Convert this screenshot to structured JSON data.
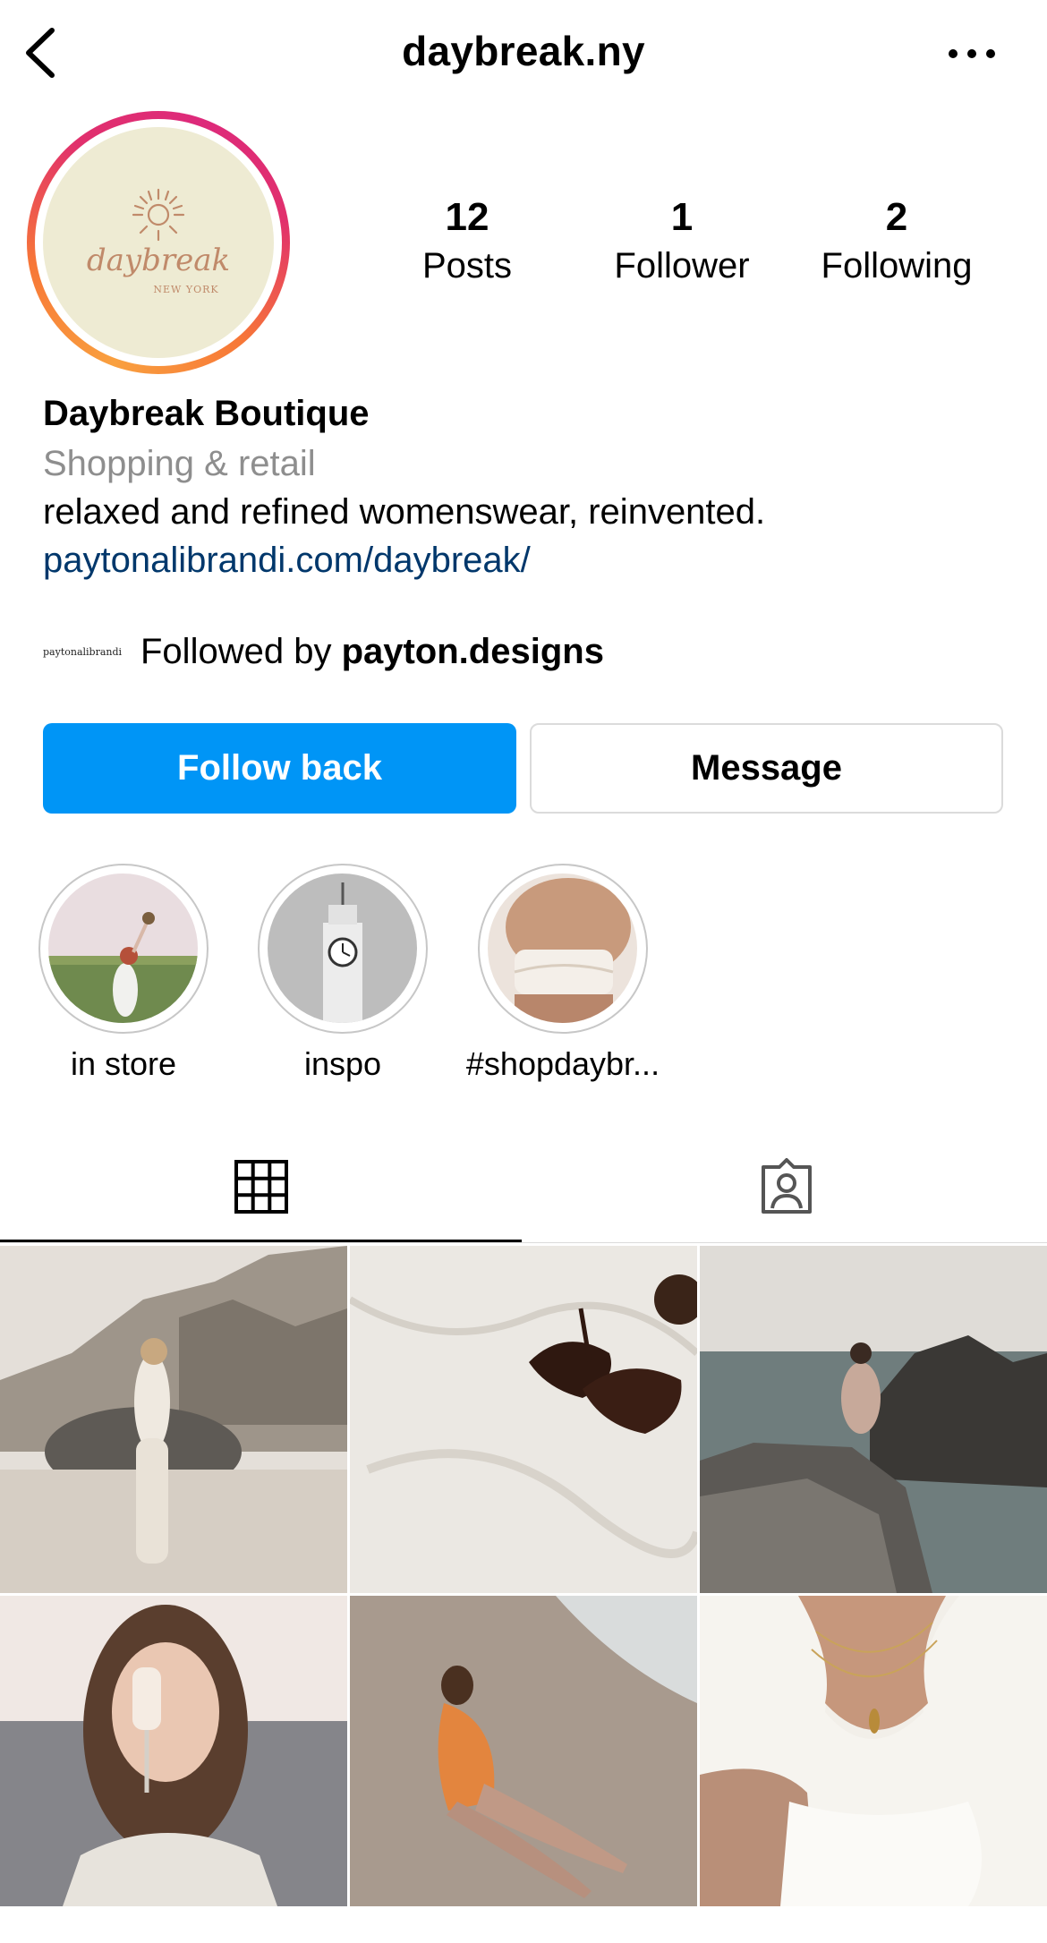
{
  "header": {
    "username": "daybreak.ny"
  },
  "avatar": {
    "logo_word": "daybreak",
    "logo_sub": "NEW YORK",
    "accent": "#c08a6a"
  },
  "stats": [
    {
      "value": "12",
      "label": "Posts"
    },
    {
      "value": "1",
      "label": "Follower"
    },
    {
      "value": "2",
      "label": "Following"
    }
  ],
  "bio": {
    "name": "Daybreak Boutique",
    "category": "Shopping & retail",
    "description": "relaxed and refined womenswear, reinvented.",
    "link": "paytonalibrandi.com/daybreak/"
  },
  "followed_by": {
    "logo_text": "paytonalibrandi",
    "prefix": "Followed by ",
    "account": "payton.designs"
  },
  "actions": {
    "follow": "Follow back",
    "message": "Message"
  },
  "highlights": [
    {
      "label": "in store"
    },
    {
      "label": "inspo"
    },
    {
      "label": "#shopdaybr..."
    }
  ],
  "tabs": [
    {
      "name": "posts-grid",
      "icon": "grid-icon",
      "active": true
    },
    {
      "name": "tagged",
      "icon": "tagged-person-icon",
      "active": false
    }
  ],
  "colors": {
    "follow_blue": "#0095f6",
    "link_blue": "#00376b",
    "muted": "#8e8e8e"
  }
}
